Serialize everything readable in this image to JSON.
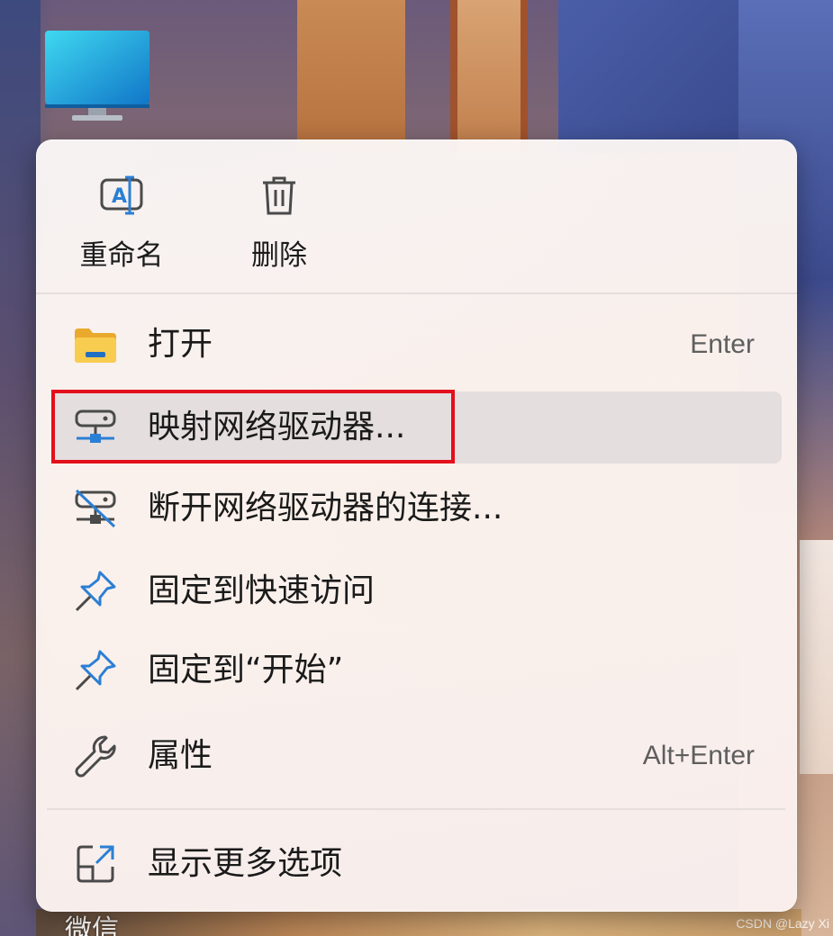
{
  "desktop": {
    "icon_name": "monitor-icon",
    "taskbar_text": "微信",
    "watermark": "CSDN @Lazy Xi"
  },
  "context_menu": {
    "top_actions": [
      {
        "label": "重命名",
        "icon": "rename-icon"
      },
      {
        "label": "删除",
        "icon": "trash-icon"
      }
    ],
    "items": [
      {
        "label": "打开",
        "shortcut": "Enter",
        "icon": "folder-icon"
      },
      {
        "label": "映射网络驱动器...",
        "shortcut": "",
        "icon": "network-drive-icon",
        "hovered": true
      },
      {
        "label": "断开网络驱动器的连接...",
        "shortcut": "",
        "icon": "disconnect-drive-icon"
      },
      {
        "label": "固定到快速访问",
        "shortcut": "",
        "icon": "pin-icon"
      },
      {
        "label": "固定到“开始”",
        "shortcut": "",
        "icon": "pin-icon"
      },
      {
        "label": "属性",
        "shortcut": "Alt+Enter",
        "icon": "wrench-icon"
      },
      {
        "label": "显示更多选项",
        "shortcut": "",
        "icon": "open-external-icon"
      }
    ]
  },
  "annotation": {
    "highlight_color": "#e30f1b"
  },
  "colors": {
    "accent_blue": "#2b7fd4",
    "folder_yellow": "#f6c445",
    "text": "#1a1a1a",
    "shortcut_text": "#5e5e5e"
  }
}
